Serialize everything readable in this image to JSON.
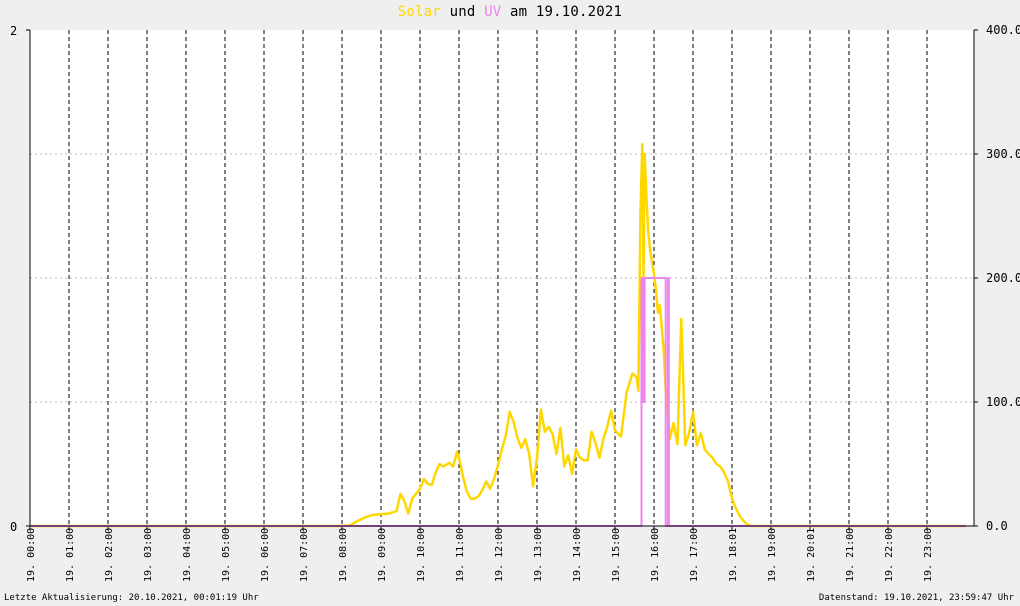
{
  "title": {
    "part_solar": "Solar",
    "part_und": " und ",
    "part_uv": "UV",
    "part_date": " am 19.10.2021",
    "color_solar": "#ffd700",
    "color_uv": "#ee82ee"
  },
  "footer": {
    "left": "Letzte Aktualisierung: 20.10.2021, 00:01:19 Uhr",
    "right": "Datenstand: 19.10.2021, 23:59:47 Uhr"
  },
  "chart_data": {
    "type": "line",
    "background": "#ffffff",
    "grid": true,
    "x_tick_labels": [
      "19. 00:00",
      "19. 01:00",
      "19. 02:00",
      "19. 03:00",
      "19. 04:00",
      "19. 05:00",
      "19. 06:00",
      "19. 07:00",
      "19. 08:00",
      "19. 09:00",
      "19. 10:00",
      "19. 11:00",
      "19. 12:00",
      "19. 13:00",
      "19. 14:00",
      "19. 15:00",
      "19. 16:00",
      "19. 17:00",
      "19. 18:01",
      "19. 19:00",
      "19. 20:01",
      "19. 21:00",
      "19. 22:00",
      "19. 23:00"
    ],
    "xlim_hours": [
      0,
      24
    ],
    "y_left": {
      "ticks": [
        "0",
        "2"
      ],
      "ylim": [
        0,
        2
      ]
    },
    "y_right": {
      "ticks": [
        "0.0",
        "100.0",
        "200.0",
        "300.0",
        "400.0"
      ],
      "ylim": [
        0,
        400
      ]
    },
    "series": [
      {
        "name": "Solar",
        "axis": "right",
        "color": "#ffd700",
        "points": [
          [
            0,
            0
          ],
          [
            8.0,
            0
          ],
          [
            8.2,
            0.5
          ],
          [
            8.4,
            4
          ],
          [
            8.6,
            7
          ],
          [
            8.8,
            9
          ],
          [
            9.0,
            9.5
          ],
          [
            9.2,
            10
          ],
          [
            9.4,
            12
          ],
          [
            9.5,
            26
          ],
          [
            9.6,
            20
          ],
          [
            9.7,
            10
          ],
          [
            9.8,
            22
          ],
          [
            10.0,
            30
          ],
          [
            10.1,
            38
          ],
          [
            10.2,
            34
          ],
          [
            10.3,
            33
          ],
          [
            10.4,
            43
          ],
          [
            10.5,
            50
          ],
          [
            10.6,
            48
          ],
          [
            10.75,
            51
          ],
          [
            10.85,
            48
          ],
          [
            10.95,
            60
          ],
          [
            11.0,
            55
          ],
          [
            11.1,
            40
          ],
          [
            11.2,
            28
          ],
          [
            11.3,
            22
          ],
          [
            11.4,
            22
          ],
          [
            11.5,
            24
          ],
          [
            11.6,
            29
          ],
          [
            11.7,
            36
          ],
          [
            11.8,
            30
          ],
          [
            11.9,
            38
          ],
          [
            12.0,
            49
          ],
          [
            12.1,
            62
          ],
          [
            12.2,
            73
          ],
          [
            12.3,
            92
          ],
          [
            12.4,
            84
          ],
          [
            12.5,
            71
          ],
          [
            12.6,
            63
          ],
          [
            12.7,
            70
          ],
          [
            12.8,
            58
          ],
          [
            12.9,
            32
          ],
          [
            13.0,
            55
          ],
          [
            13.1,
            94
          ],
          [
            13.2,
            76
          ],
          [
            13.3,
            80
          ],
          [
            13.4,
            74
          ],
          [
            13.5,
            58
          ],
          [
            13.6,
            79
          ],
          [
            13.7,
            48
          ],
          [
            13.8,
            57
          ],
          [
            13.9,
            42
          ],
          [
            14.0,
            62
          ],
          [
            14.1,
            55
          ],
          [
            14.2,
            53
          ],
          [
            14.3,
            53
          ],
          [
            14.4,
            76
          ],
          [
            14.5,
            67
          ],
          [
            14.6,
            55
          ],
          [
            14.7,
            70
          ],
          [
            14.8,
            80
          ],
          [
            14.9,
            93
          ],
          [
            15.0,
            77
          ],
          [
            15.15,
            72
          ],
          [
            15.3,
            108
          ],
          [
            15.45,
            123
          ],
          [
            15.55,
            120
          ],
          [
            15.6,
            109
          ],
          [
            15.65,
            250
          ],
          [
            15.7,
            308
          ],
          [
            15.73,
            200
          ],
          [
            15.76,
            300
          ],
          [
            15.8,
            270
          ],
          [
            15.85,
            238
          ],
          [
            15.9,
            223
          ],
          [
            16.0,
            203
          ],
          [
            16.05,
            190
          ],
          [
            16.1,
            172
          ],
          [
            16.15,
            178
          ],
          [
            16.2,
            160
          ],
          [
            16.25,
            140
          ],
          [
            16.3,
            110
          ],
          [
            16.35,
            95
          ],
          [
            16.4,
            70
          ],
          [
            16.5,
            83
          ],
          [
            16.6,
            66
          ],
          [
            16.7,
            167
          ],
          [
            16.75,
            120
          ],
          [
            16.8,
            65
          ],
          [
            16.9,
            75
          ],
          [
            17.0,
            92
          ],
          [
            17.1,
            65
          ],
          [
            17.2,
            75
          ],
          [
            17.3,
            62
          ],
          [
            17.4,
            58
          ],
          [
            17.5,
            55
          ],
          [
            17.6,
            50
          ],
          [
            17.7,
            48
          ],
          [
            17.8,
            43
          ],
          [
            17.9,
            36
          ],
          [
            18.0,
            22
          ],
          [
            18.1,
            14
          ],
          [
            18.2,
            8
          ],
          [
            18.3,
            4
          ],
          [
            18.4,
            1
          ],
          [
            18.5,
            0
          ],
          [
            24,
            0
          ]
        ]
      },
      {
        "name": "UV",
        "axis": "left",
        "color": "#ee82ee",
        "points": [
          [
            0,
            0
          ],
          [
            15.68,
            0
          ],
          [
            15.68,
            1
          ],
          [
            15.72,
            1
          ],
          [
            15.72,
            0.5
          ],
          [
            15.76,
            0.5
          ],
          [
            15.76,
            1
          ],
          [
            16.3,
            1
          ],
          [
            16.3,
            0
          ],
          [
            16.36,
            0
          ],
          [
            16.36,
            1
          ],
          [
            16.38,
            1
          ],
          [
            16.38,
            0
          ],
          [
            24,
            0
          ]
        ]
      }
    ]
  }
}
